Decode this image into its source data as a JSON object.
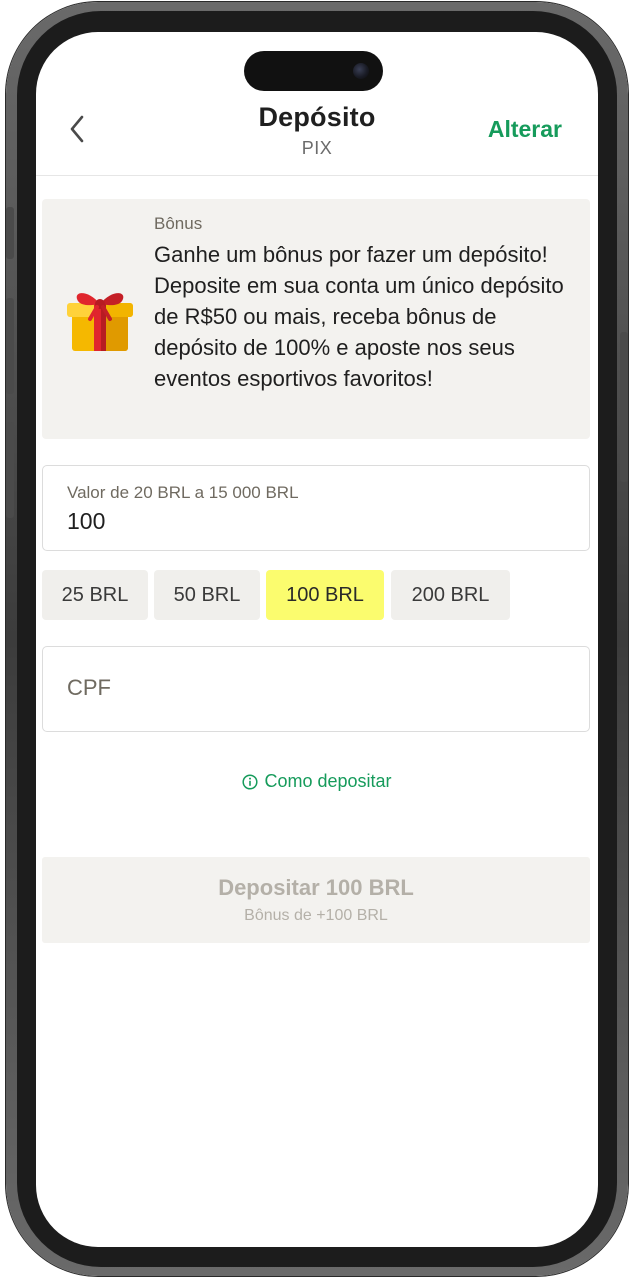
{
  "header": {
    "title": "Depósito",
    "subtitle": "PIX",
    "change_label": "Alterar"
  },
  "bonus": {
    "label": "Bônus",
    "text": "Ganhe um bônus por fazer um depósito! Deposite em sua conta um único depósito de R$50 ou mais, receba bônus de depósito de 100% e aposte nos seus eventos esportivos favoritos!",
    "icon": "gift-icon"
  },
  "amount": {
    "label": "Valor de 20 BRL a 15 000 BRL",
    "value": "100"
  },
  "quick_amounts": [
    {
      "label": "25 BRL",
      "selected": false
    },
    {
      "label": "50 BRL",
      "selected": false
    },
    {
      "label": "100 BRL",
      "selected": true
    },
    {
      "label": "200 BRL",
      "selected": false
    }
  ],
  "cpf": {
    "placeholder": "CPF",
    "value": ""
  },
  "how_to": {
    "label": "Como depositar",
    "icon": "info-icon"
  },
  "deposit_button": {
    "label": "Depositar 100 BRL",
    "sublabel": "Bônus de +100 BRL"
  },
  "colors": {
    "accent": "#169b5b",
    "chip_selected": "#fbfc6e",
    "card_bg": "#f3f2ef",
    "disabled_text": "#b4b0a8"
  }
}
